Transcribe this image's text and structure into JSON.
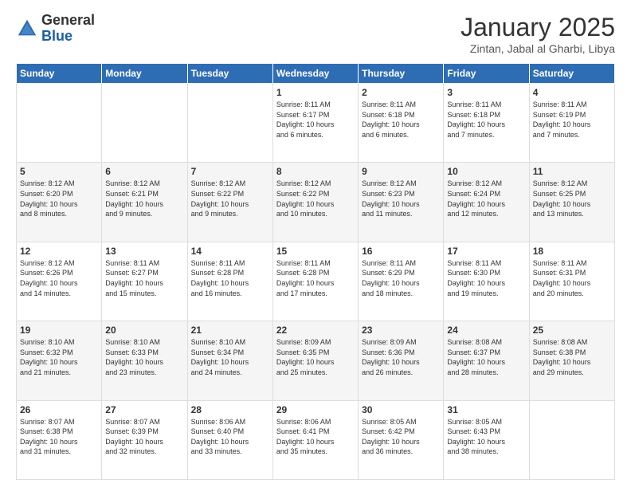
{
  "logo": {
    "general": "General",
    "blue": "Blue"
  },
  "header": {
    "month": "January 2025",
    "location": "Zintan, Jabal al Gharbi, Libya"
  },
  "weekdays": [
    "Sunday",
    "Monday",
    "Tuesday",
    "Wednesday",
    "Thursday",
    "Friday",
    "Saturday"
  ],
  "weeks": [
    [
      {
        "day": "",
        "info": ""
      },
      {
        "day": "",
        "info": ""
      },
      {
        "day": "",
        "info": ""
      },
      {
        "day": "1",
        "info": "Sunrise: 8:11 AM\nSunset: 6:17 PM\nDaylight: 10 hours\nand 6 minutes."
      },
      {
        "day": "2",
        "info": "Sunrise: 8:11 AM\nSunset: 6:18 PM\nDaylight: 10 hours\nand 6 minutes."
      },
      {
        "day": "3",
        "info": "Sunrise: 8:11 AM\nSunset: 6:18 PM\nDaylight: 10 hours\nand 7 minutes."
      },
      {
        "day": "4",
        "info": "Sunrise: 8:11 AM\nSunset: 6:19 PM\nDaylight: 10 hours\nand 7 minutes."
      }
    ],
    [
      {
        "day": "5",
        "info": "Sunrise: 8:12 AM\nSunset: 6:20 PM\nDaylight: 10 hours\nand 8 minutes."
      },
      {
        "day": "6",
        "info": "Sunrise: 8:12 AM\nSunset: 6:21 PM\nDaylight: 10 hours\nand 9 minutes."
      },
      {
        "day": "7",
        "info": "Sunrise: 8:12 AM\nSunset: 6:22 PM\nDaylight: 10 hours\nand 9 minutes."
      },
      {
        "day": "8",
        "info": "Sunrise: 8:12 AM\nSunset: 6:22 PM\nDaylight: 10 hours\nand 10 minutes."
      },
      {
        "day": "9",
        "info": "Sunrise: 8:12 AM\nSunset: 6:23 PM\nDaylight: 10 hours\nand 11 minutes."
      },
      {
        "day": "10",
        "info": "Sunrise: 8:12 AM\nSunset: 6:24 PM\nDaylight: 10 hours\nand 12 minutes."
      },
      {
        "day": "11",
        "info": "Sunrise: 8:12 AM\nSunset: 6:25 PM\nDaylight: 10 hours\nand 13 minutes."
      }
    ],
    [
      {
        "day": "12",
        "info": "Sunrise: 8:12 AM\nSunset: 6:26 PM\nDaylight: 10 hours\nand 14 minutes."
      },
      {
        "day": "13",
        "info": "Sunrise: 8:11 AM\nSunset: 6:27 PM\nDaylight: 10 hours\nand 15 minutes."
      },
      {
        "day": "14",
        "info": "Sunrise: 8:11 AM\nSunset: 6:28 PM\nDaylight: 10 hours\nand 16 minutes."
      },
      {
        "day": "15",
        "info": "Sunrise: 8:11 AM\nSunset: 6:28 PM\nDaylight: 10 hours\nand 17 minutes."
      },
      {
        "day": "16",
        "info": "Sunrise: 8:11 AM\nSunset: 6:29 PM\nDaylight: 10 hours\nand 18 minutes."
      },
      {
        "day": "17",
        "info": "Sunrise: 8:11 AM\nSunset: 6:30 PM\nDaylight: 10 hours\nand 19 minutes."
      },
      {
        "day": "18",
        "info": "Sunrise: 8:11 AM\nSunset: 6:31 PM\nDaylight: 10 hours\nand 20 minutes."
      }
    ],
    [
      {
        "day": "19",
        "info": "Sunrise: 8:10 AM\nSunset: 6:32 PM\nDaylight: 10 hours\nand 21 minutes."
      },
      {
        "day": "20",
        "info": "Sunrise: 8:10 AM\nSunset: 6:33 PM\nDaylight: 10 hours\nand 23 minutes."
      },
      {
        "day": "21",
        "info": "Sunrise: 8:10 AM\nSunset: 6:34 PM\nDaylight: 10 hours\nand 24 minutes."
      },
      {
        "day": "22",
        "info": "Sunrise: 8:09 AM\nSunset: 6:35 PM\nDaylight: 10 hours\nand 25 minutes."
      },
      {
        "day": "23",
        "info": "Sunrise: 8:09 AM\nSunset: 6:36 PM\nDaylight: 10 hours\nand 26 minutes."
      },
      {
        "day": "24",
        "info": "Sunrise: 8:08 AM\nSunset: 6:37 PM\nDaylight: 10 hours\nand 28 minutes."
      },
      {
        "day": "25",
        "info": "Sunrise: 8:08 AM\nSunset: 6:38 PM\nDaylight: 10 hours\nand 29 minutes."
      }
    ],
    [
      {
        "day": "26",
        "info": "Sunrise: 8:07 AM\nSunset: 6:38 PM\nDaylight: 10 hours\nand 31 minutes."
      },
      {
        "day": "27",
        "info": "Sunrise: 8:07 AM\nSunset: 6:39 PM\nDaylight: 10 hours\nand 32 minutes."
      },
      {
        "day": "28",
        "info": "Sunrise: 8:06 AM\nSunset: 6:40 PM\nDaylight: 10 hours\nand 33 minutes."
      },
      {
        "day": "29",
        "info": "Sunrise: 8:06 AM\nSunset: 6:41 PM\nDaylight: 10 hours\nand 35 minutes."
      },
      {
        "day": "30",
        "info": "Sunrise: 8:05 AM\nSunset: 6:42 PM\nDaylight: 10 hours\nand 36 minutes."
      },
      {
        "day": "31",
        "info": "Sunrise: 8:05 AM\nSunset: 6:43 PM\nDaylight: 10 hours\nand 38 minutes."
      },
      {
        "day": "",
        "info": ""
      }
    ]
  ]
}
